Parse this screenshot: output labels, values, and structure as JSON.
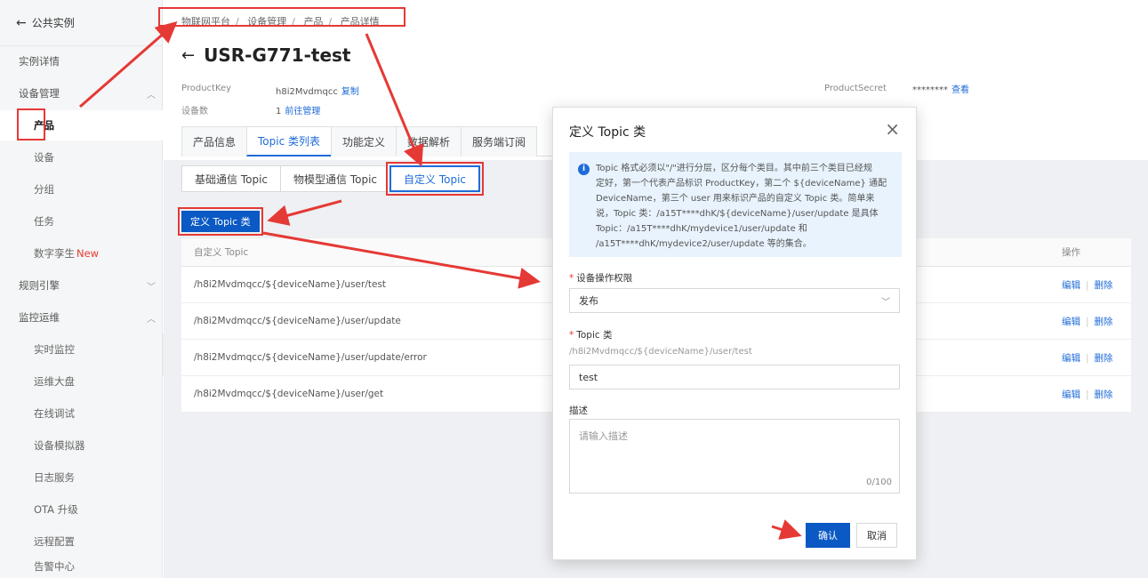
{
  "sidebar": {
    "back_label": "公共实例",
    "items": [
      {
        "label": "实例详情"
      },
      {
        "label": "设备管理",
        "chevron": "︿"
      },
      {
        "label": "产品"
      },
      {
        "label": "设备"
      },
      {
        "label": "分组"
      },
      {
        "label": "任务"
      },
      {
        "label": "数字孪生",
        "badge": "New"
      },
      {
        "label": "规则引擎",
        "chevron": "﹀"
      },
      {
        "label": "监控运维",
        "chevron": "︿"
      },
      {
        "label": "实时监控"
      },
      {
        "label": "运维大盘"
      },
      {
        "label": "在线调试"
      },
      {
        "label": "设备模拟器"
      },
      {
        "label": "日志服务"
      },
      {
        "label": "OTA 升级"
      },
      {
        "label": "远程配置"
      },
      {
        "label": "告警中心"
      }
    ]
  },
  "breadcrumb": [
    "物联网平台",
    "设备管理",
    "产品",
    "产品详情"
  ],
  "page": {
    "title": "USR-G771-test",
    "product_key_label": "ProductKey",
    "product_key_value": "h8i2Mvdmqcc",
    "copy_label": "复制",
    "device_count_label": "设备数",
    "device_count_value": "1",
    "manage_link": "前往管理",
    "product_secret_label": "ProductSecret",
    "product_secret_value": "********",
    "view_label": "查看"
  },
  "tabs": [
    "产品信息",
    "Topic 类列表",
    "功能定义",
    "数据解析",
    "服务端订阅"
  ],
  "subtabs": [
    "基础通信 Topic",
    "物模型通信 Topic",
    "自定义 Topic"
  ],
  "define_topic_button": "定义 Topic 类",
  "table": {
    "col_topic": "自定义 Topic",
    "col_ops": "操作",
    "rows": [
      {
        "topic": "/h8i2Mvdmqcc/${deviceName}/user/test"
      },
      {
        "topic": "/h8i2Mvdmqcc/${deviceName}/user/update"
      },
      {
        "topic": "/h8i2Mvdmqcc/${deviceName}/user/update/error"
      },
      {
        "topic": "/h8i2Mvdmqcc/${deviceName}/user/get"
      }
    ],
    "edit_label": "编辑",
    "delete_label": "删除"
  },
  "modal": {
    "title": "定义 Topic 类",
    "info_lines": [
      "Topic 格式必须以\"/\"进行分层，区分每个类目。其中前三个类目已经规",
      "定好，第一个代表产品标识 ProductKey，第二个 ${deviceName} 通配",
      "DeviceName，第三个 user 用来标识产品的自定义 Topic 类。简单来",
      "说，Topic 类：/a15T****dhK/${deviceName}/user/update 是具体",
      "Topic：/a15T****dhK/mydevice1/user/update 和",
      "/a15T****dhK/mydevice2/user/update 等的集合。"
    ],
    "permission_label": "设备操作权限",
    "permission_value": "发布",
    "topic_label": "Topic 类",
    "topic_prefix": "/h8i2Mvdmqcc/${deviceName}/user/test",
    "topic_value": "test",
    "desc_label": "描述",
    "desc_placeholder": "请输入描述",
    "desc_counter": "0/100",
    "ok_label": "确认",
    "cancel_label": "取消"
  },
  "colors": {
    "accent": "#1f6bd8",
    "primary_button": "#0a59c4",
    "annotation": "#e53935"
  }
}
